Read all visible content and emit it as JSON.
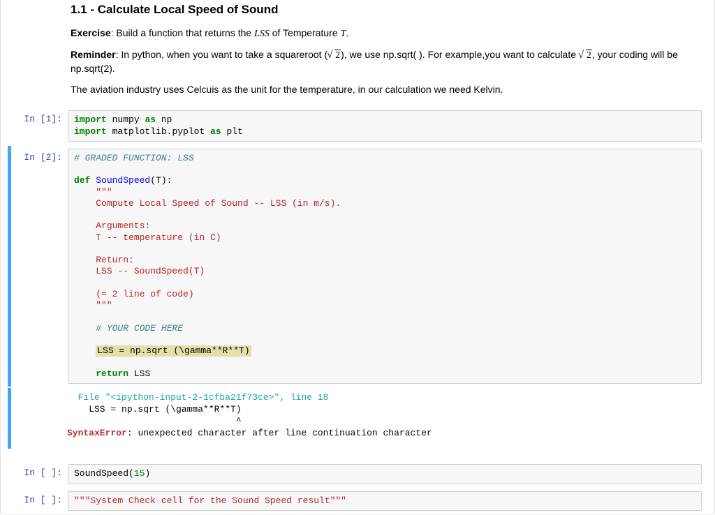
{
  "heading": "1.1 - Calculate Local Speed of Sound",
  "intro": {
    "exercise_label": "Exercise",
    "exercise_text_before": ": Build a function that returns the ",
    "exercise_math1": "LSS",
    "exercise_text_mid": " of Temperature ",
    "exercise_math2": "T",
    "exercise_text_after": ".",
    "reminder_label": "Reminder",
    "reminder_pre": ": In python, when you want to take a squareroot (",
    "reminder_sq2": "2",
    "reminder_mid": "), we use np.sqrt( ). For example,you want to calculate ",
    "reminder_sq2b": "2",
    "reminder_post": ", your coding will be np.sqrt(2).",
    "note": "The aviation industry uses Celcuis as the unit for the temperature, in our calculation we need Kelvin."
  },
  "cells": {
    "c1": {
      "prompt": "In [1]:",
      "code": {
        "l1_kw": "import",
        "l1_mod": "numpy",
        "l1_as": "as",
        "l1_alias": "np",
        "l2_kw": "import",
        "l2_mod": "matplotlib.pyplot",
        "l2_as": "as",
        "l2_alias": "plt"
      }
    },
    "c2": {
      "prompt": "In [2]:",
      "code": {
        "l1": "# GRADED FUNCTION: LSS",
        "l2_def": "def",
        "l2_name": "SoundSpeed",
        "l2_sig": "(T):",
        "doc1": "\"\"\"",
        "doc2": "Compute Local Speed of Sound -- LSS (in m/s).",
        "doc3": "Arguments:",
        "doc4": "T -- temperature (in C)",
        "doc5": "Return:",
        "doc6": "LSS -- SoundSpeed(T)",
        "doc7": "(≈ 2 line of code)",
        "doc8": "\"\"\"",
        "comment_here": "# YOUR CODE HERE",
        "hl_line": "LSS = np.sqrt (\\gamma**R**T)",
        "ret_kw": "return",
        "ret_val": "LSS"
      },
      "output": {
        "file_label": "  File ",
        "filename": "\"<ipython-input-2-1cfba21f73ce>\"",
        "line_label": ", line ",
        "lineno": "18",
        "code_echo": "    LSS = np.sqrt (\\gamma**R**T)",
        "caret": "                               ^",
        "err_name": "SyntaxError",
        "err_sep": ": ",
        "err_msg": "unexpected character after line continuation character"
      }
    },
    "c3": {
      "prompt": "In [ ]:",
      "code": {
        "call_fn": "SoundSpeed",
        "call_open": "(",
        "call_arg": "15",
        "call_close": ")"
      }
    },
    "c4": {
      "prompt": "In [ ]:",
      "code": {
        "line": "\"\"\"System Check cell for the Sound Speed result\"\"\""
      }
    }
  }
}
